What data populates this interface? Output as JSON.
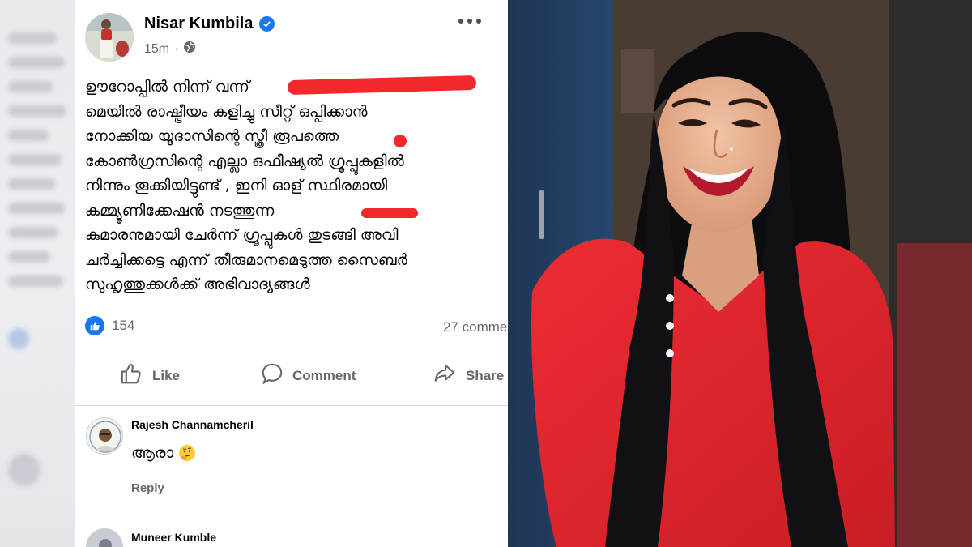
{
  "post": {
    "author": "Nisar Kumbila",
    "time": "15m",
    "body_lines": [
      "ഊറോപ്പിൽ നിന്ന് വന്ന്",
      "മെയിൽ രാഷ്ട്രീയം കളിച്ചു സീറ്റ് ഒപ്പിക്കാൻ",
      "നോക്കിയ യൂദാസിന്റെ സ്ത്രീ രൂപത്തെ",
      "കോൺഗ്രസിന്റെ എല്ലാ ഒഫീഷ്യൽ ഗ്രൂപ്പുകളിൽ",
      "നിന്നും തൂക്കിയിട്ടുണ്ട് , ഇനി ഓള് സ്ഥിരമായി",
      "കമ്മ്യൂണിക്കേഷൻ നടത്തുന്ന",
      "കുമാരനുമായി ചേർന്ന് ഗ്രൂപ്പുകൾ തുടങ്ങി അവി",
      "ചർച്ചിക്കട്ടെ എന്ന് തീരുമാനമെടുത്ത സൈബർ",
      "സുഹൃത്തുക്കൾക്ക് അഭിവാദ്യങ്ങൾ"
    ],
    "reaction_count": "154",
    "comment_count": "27 comme",
    "actions": {
      "like": "Like",
      "comment": "Comment",
      "share": "Share"
    }
  },
  "comments": [
    {
      "name": "Rajesh Channamcheril",
      "text": "ആരാ",
      "emoji": "🤔",
      "reply": "Reply"
    },
    {
      "name": "Muneer Kumble"
    }
  ],
  "colors": {
    "facebook_blue": "#1877f2",
    "redaction_red": "#f2282c",
    "shirt_red": "#e5262e"
  },
  "icons": [
    "verified-badge-icon",
    "globe-icon",
    "more-options-icon",
    "like-reaction-icon",
    "thumbs-up-icon",
    "comment-bubble-icon",
    "share-arrow-icon",
    "thinking-face-emoji"
  ]
}
